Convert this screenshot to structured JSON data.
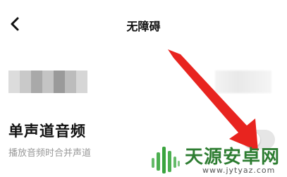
{
  "header": {
    "title": "无障碍"
  },
  "setting": {
    "title": "单声道音频",
    "subtitle": "播放音频时合并声道",
    "toggle_state": "off"
  },
  "icons": {
    "back": "chevron-left-icon",
    "annotation": "red-arrow-icon"
  },
  "watermark": {
    "name": "天源安卓网",
    "url": "www.jytyaz.com"
  },
  "colors": {
    "arrow": "#e8241f",
    "watermark": "#2e7d32"
  }
}
